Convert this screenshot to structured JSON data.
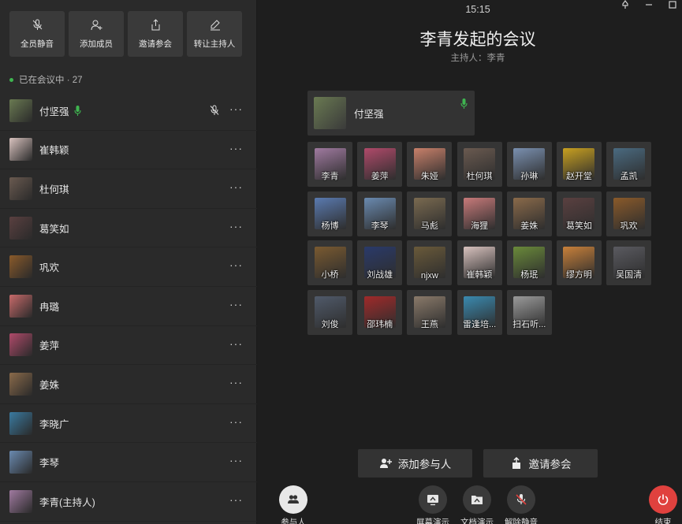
{
  "toolbar": [
    {
      "label": "全员静音",
      "icon": "mic-off-icon"
    },
    {
      "label": "添加成员",
      "icon": "add-user-icon"
    },
    {
      "label": "邀请参会",
      "icon": "share-icon"
    },
    {
      "label": "转让主持人",
      "icon": "transfer-host-icon"
    }
  ],
  "status": {
    "text": "已在会议中 · 27"
  },
  "participants": [
    {
      "name": "付坚强",
      "speaking": true,
      "muted_icon": true,
      "color": "#6a7a52"
    },
    {
      "name": "崔韩颖",
      "color": "#d8c2be"
    },
    {
      "name": "杜何琪",
      "color": "#6a5a50"
    },
    {
      "name": "葛笑如",
      "color": "#5a4040"
    },
    {
      "name": "巩欢",
      "color": "#8a5a2a"
    },
    {
      "name": "冉璐",
      "color": "#c86a6a"
    },
    {
      "name": "姜萍",
      "color": "#b04a6a"
    },
    {
      "name": "姜姝",
      "color": "#8a6a4a"
    },
    {
      "name": "李晓广",
      "color": "#3a7aa0"
    },
    {
      "name": "李琴",
      "color": "#6a8ab0"
    },
    {
      "name": "李青(主持人)",
      "color": "#a07aa0"
    }
  ],
  "more_glyph": "···",
  "meeting": {
    "time": "15:15",
    "title": "李青发起的会议",
    "host": "主持人：李青",
    "speaker": {
      "name": "付坚强",
      "color": "#6a7a52"
    }
  },
  "grid": [
    {
      "name": "李青",
      "color": "#a07aa0"
    },
    {
      "name": "姜萍",
      "color": "#b04a6a"
    },
    {
      "name": "朱娅",
      "color": "#c8806a"
    },
    {
      "name": "杜何琪",
      "color": "#6a5a50"
    },
    {
      "name": "孙琳",
      "color": "#7a90b0"
    },
    {
      "name": "赵开堂",
      "color": "#c8a020"
    },
    {
      "name": "孟凯",
      "color": "#4a6a80"
    },
    {
      "name": "杨博",
      "color": "#5a7ab0"
    },
    {
      "name": "李琴",
      "color": "#6a8ab0"
    },
    {
      "name": "马彪",
      "color": "#7a6a50"
    },
    {
      "name": "海狸",
      "color": "#c87a7a"
    },
    {
      "name": "姜姝",
      "color": "#8a6a4a"
    },
    {
      "name": "葛笑如",
      "color": "#5a4040"
    },
    {
      "name": "巩欢",
      "color": "#8a5a2a"
    },
    {
      "name": "小桥",
      "color": "#7a5a30"
    },
    {
      "name": "刘战雄",
      "color": "#2a3a6a"
    },
    {
      "name": "njxw",
      "color": "#6a5a3a"
    },
    {
      "name": "崔韩颖",
      "color": "#d8c2be"
    },
    {
      "name": "杨珉",
      "color": "#6a8a3a"
    },
    {
      "name": "缪方明",
      "color": "#c8803a"
    },
    {
      "name": "吴国清",
      "color": "#5a5a60"
    },
    {
      "name": "刘俊",
      "color": "#505a6a"
    },
    {
      "name": "邵玮楠",
      "color": "#a02a2a"
    },
    {
      "name": "王燕",
      "color": "#8a7a6a"
    },
    {
      "name": "雷逢培...",
      "color": "#3a8ab0"
    },
    {
      "name": "扫石听...",
      "color": "#9a9a9a"
    }
  ],
  "actions": {
    "add": "添加参与人",
    "invite": "邀请参会"
  },
  "bottom": {
    "participants": "参与人",
    "screen_share": "屏幕演示",
    "doc_share": "文档演示",
    "unmute": "解除静音",
    "end": "结束"
  },
  "colors": {
    "accent_green": "#3fb550",
    "end_red": "#e0413e"
  }
}
